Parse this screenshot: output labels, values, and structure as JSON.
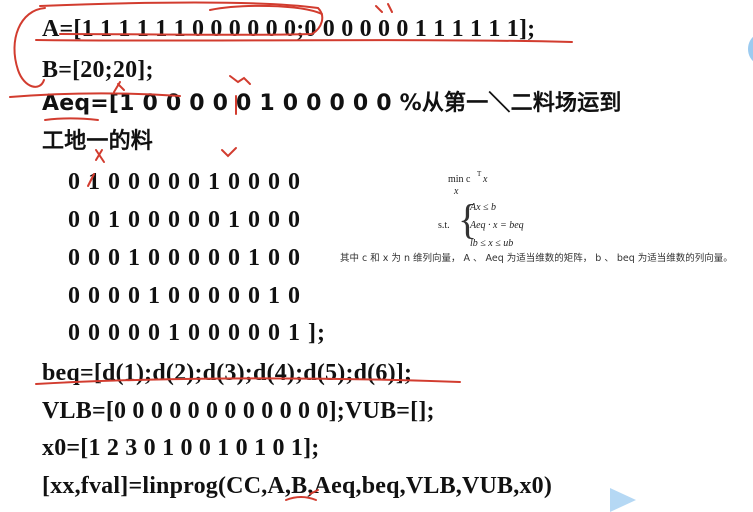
{
  "code": {
    "line_a": "A=[1 1 1 1 1 1 0 0 0 0 0 0;0 0 0 0 0 0 1 1 1 1 1 1];",
    "line_b": "B=[20;20];",
    "line_aeq": "Aeq=[1 0 0 0 0 0 1 0 0 0 0 0 %从第一＼二料场运到",
    "line_aeq_cont": "工地一的料",
    "aeq_rows": [
      "0 1 0 0 0 0 0 1 0 0 0 0",
      "0 0 1 0 0 0 0 0 1 0 0 0",
      "0 0 0 1 0 0 0 0 0 1 0 0",
      "0 0 0 0 1 0 0 0 0 0 1 0",
      "0 0 0 0 0 1 0 0 0 0 0 1 ];"
    ],
    "line_beq": "beq=[d(1);d(2);d(3);d(4);d(5);d(6)];",
    "line_vlb": "VLB=[0 0 0 0 0 0 0 0 0 0 0 0];VUB=[];",
    "line_x0": "x0=[1 2 3 0 1 0 0 1 0 1 0 1];",
    "line_call": "[xx,fval]=linprog(CC,A,B,Aeq,beq,VLB,VUB,x0)"
  },
  "formula": {
    "min_label": "min c",
    "min_sup": "T",
    "min_var": "x",
    "under_var": "x",
    "st_label": "s.t.",
    "c1": "Ax ≤ b",
    "c2": "Aeq · x = beq",
    "c3": "lb ≤ x ≤ ub",
    "note": "其中 c 和 x 为 n 维列向量， A 、 Aeq 为适当维数的矩阵， b 、 beq 为适当维数的列向量。"
  },
  "colors": {
    "annotation": "#d23c2f",
    "deco_blue": "#5aa9e6"
  }
}
